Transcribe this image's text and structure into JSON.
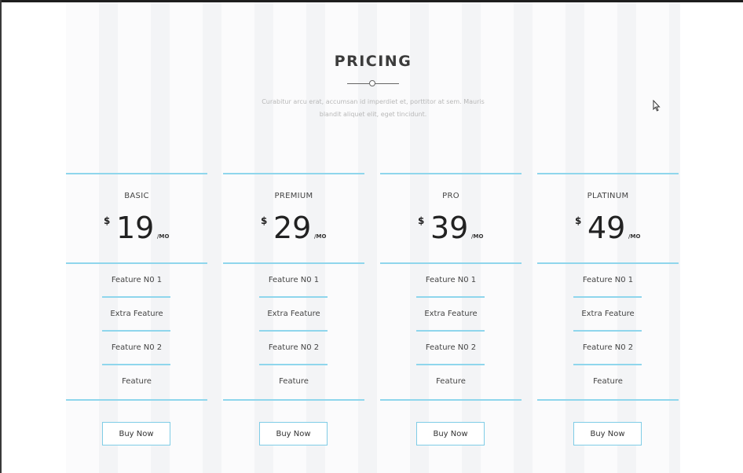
{
  "header": {
    "title": "PRICING",
    "subtitle": "Curabitur arcu erat, accumsan id imperdiet et, porttitor at sem. Mauris blandit aliquet elit, eget tincidunt."
  },
  "plans": [
    {
      "name": "BASIC",
      "currency": "$",
      "amount": "19",
      "period": "/MO",
      "features": [
        "Feature N0 1",
        "Extra Feature",
        "Feature N0 2",
        "Feature"
      ],
      "button_label": "Buy Now"
    },
    {
      "name": "PREMIUM",
      "currency": "$",
      "amount": "29",
      "period": "/MO",
      "features": [
        "Feature N0 1",
        "Extra Feature",
        "Feature N0 2",
        "Feature"
      ],
      "button_label": "Buy Now"
    },
    {
      "name": "PRO",
      "currency": "$",
      "amount": "39",
      "period": "/MO",
      "features": [
        "Feature N0 1",
        "Extra Feature",
        "Feature N0 2",
        "Feature"
      ],
      "button_label": "Buy Now"
    },
    {
      "name": "PLATINUM",
      "currency": "$",
      "amount": "49",
      "period": "/MO",
      "features": [
        "Feature N0 1",
        "Extra Feature",
        "Feature N0 2",
        "Feature"
      ],
      "button_label": "Buy Now"
    }
  ],
  "colors": {
    "accent": "#8fd6ec",
    "text": "#444444",
    "price": "#222222",
    "stripe_light": "#fbfbfc",
    "stripe_dark": "#f3f4f6"
  },
  "icons": {
    "cursor": "mouse-pointer-icon",
    "divider": "circle-divider-icon"
  }
}
